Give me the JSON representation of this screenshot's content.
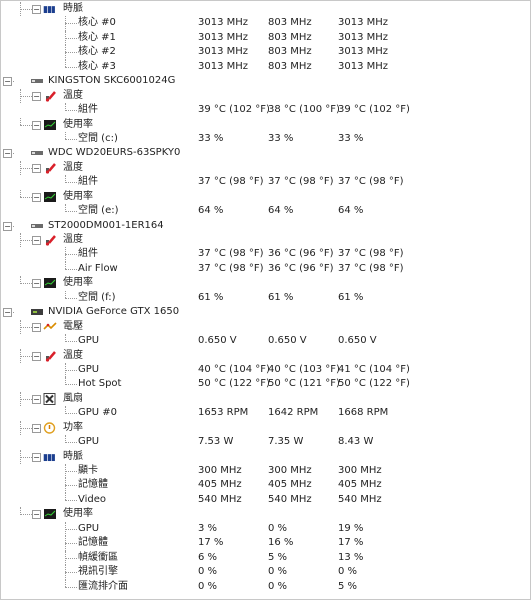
{
  "rows": [
    {
      "level": 1,
      "type": "group",
      "icon": "clock-icon",
      "label": "時脈",
      "last": false
    },
    {
      "level": 2,
      "type": "item",
      "label": "核心 #0",
      "values": [
        "3013 MHz",
        "803 MHz",
        "3013 MHz"
      ],
      "last": false
    },
    {
      "level": 2,
      "type": "item",
      "label": "核心 #1",
      "values": [
        "3013 MHz",
        "803 MHz",
        "3013 MHz"
      ],
      "last": false
    },
    {
      "level": 2,
      "type": "item",
      "label": "核心 #2",
      "values": [
        "3013 MHz",
        "803 MHz",
        "3013 MHz"
      ],
      "last": false
    },
    {
      "level": 2,
      "type": "item",
      "label": "核心 #3",
      "values": [
        "3013 MHz",
        "803 MHz",
        "3013 MHz"
      ],
      "last": true
    },
    {
      "level": 0,
      "type": "device",
      "icon": "drive-icon",
      "label": "KINGSTON SKC6001024G"
    },
    {
      "level": 1,
      "type": "group",
      "icon": "thermometer-icon",
      "label": "溫度",
      "last": false
    },
    {
      "level": 2,
      "type": "item",
      "label": "組件",
      "values": [
        "39 °C  (102 °F)",
        "38 °C  (100 °F)",
        "39 °C  (102 °F)"
      ],
      "last": true
    },
    {
      "level": 1,
      "type": "group",
      "icon": "usage-icon",
      "label": "使用率",
      "last": true
    },
    {
      "level": 2,
      "type": "item",
      "label": "空間 (c:)",
      "values": [
        "33 %",
        "33 %",
        "33 %"
      ],
      "last": true
    },
    {
      "level": 0,
      "type": "device",
      "icon": "drive-icon",
      "label": "WDC WD20EURS-63SPKY0"
    },
    {
      "level": 1,
      "type": "group",
      "icon": "thermometer-icon",
      "label": "溫度",
      "last": false
    },
    {
      "level": 2,
      "type": "item",
      "label": "組件",
      "values": [
        "37 °C  (98 °F)",
        "37 °C  (98 °F)",
        "37 °C  (98 °F)"
      ],
      "last": true
    },
    {
      "level": 1,
      "type": "group",
      "icon": "usage-icon",
      "label": "使用率",
      "last": true
    },
    {
      "level": 2,
      "type": "item",
      "label": "空間 (e:)",
      "values": [
        "64 %",
        "64 %",
        "64 %"
      ],
      "last": true
    },
    {
      "level": 0,
      "type": "device",
      "icon": "drive-icon",
      "label": "ST2000DM001-1ER164"
    },
    {
      "level": 1,
      "type": "group",
      "icon": "thermometer-icon",
      "label": "溫度",
      "last": false
    },
    {
      "level": 2,
      "type": "item",
      "label": "組件",
      "values": [
        "37 °C  (98 °F)",
        "36 °C  (96 °F)",
        "37 °C  (98 °F)"
      ],
      "last": false
    },
    {
      "level": 2,
      "type": "item",
      "label": "Air Flow",
      "values": [
        "37 °C  (98 °F)",
        "36 °C  (96 °F)",
        "37 °C  (98 °F)"
      ],
      "last": true
    },
    {
      "level": 1,
      "type": "group",
      "icon": "usage-icon",
      "label": "使用率",
      "last": true
    },
    {
      "level": 2,
      "type": "item",
      "label": "空間 (f:)",
      "values": [
        "61 %",
        "61 %",
        "61 %"
      ],
      "last": true
    },
    {
      "level": 0,
      "type": "device",
      "icon": "gpu-icon",
      "label": "NVIDIA GeForce GTX 1650"
    },
    {
      "level": 1,
      "type": "group",
      "icon": "voltage-icon",
      "label": "電壓",
      "last": false
    },
    {
      "level": 2,
      "type": "item",
      "label": "GPU",
      "values": [
        "0.650 V",
        "0.650 V",
        "0.650 V"
      ],
      "last": true
    },
    {
      "level": 1,
      "type": "group",
      "icon": "thermometer-icon",
      "label": "溫度",
      "last": false
    },
    {
      "level": 2,
      "type": "item",
      "label": "GPU",
      "values": [
        "40 °C  (104 °F)",
        "40 °C  (103 °F)",
        "41 °C  (104 °F)"
      ],
      "last": false
    },
    {
      "level": 2,
      "type": "item",
      "label": "Hot Spot",
      "values": [
        "50 °C  (122 °F)",
        "50 °C  (121 °F)",
        "50 °C  (122 °F)"
      ],
      "last": true
    },
    {
      "level": 1,
      "type": "group",
      "icon": "fan-icon",
      "label": "風扇",
      "last": false
    },
    {
      "level": 2,
      "type": "item",
      "label": "GPU #0",
      "values": [
        "1653 RPM",
        "1642 RPM",
        "1668 RPM"
      ],
      "last": true
    },
    {
      "level": 1,
      "type": "group",
      "icon": "power-icon",
      "label": "功率",
      "last": false
    },
    {
      "level": 2,
      "type": "item",
      "label": "GPU",
      "values": [
        "7.53 W",
        "7.35 W",
        "8.43 W"
      ],
      "last": true
    },
    {
      "level": 1,
      "type": "group",
      "icon": "clock-icon",
      "label": "時脈",
      "last": false
    },
    {
      "level": 2,
      "type": "item",
      "label": "顯卡",
      "values": [
        "300 MHz",
        "300 MHz",
        "300 MHz"
      ],
      "last": false
    },
    {
      "level": 2,
      "type": "item",
      "label": "記憶體",
      "values": [
        "405 MHz",
        "405 MHz",
        "405 MHz"
      ],
      "last": false
    },
    {
      "level": 2,
      "type": "item",
      "label": "Video",
      "values": [
        "540 MHz",
        "540 MHz",
        "540 MHz"
      ],
      "last": true
    },
    {
      "level": 1,
      "type": "group",
      "icon": "usage-icon",
      "label": "使用率",
      "last": true
    },
    {
      "level": 2,
      "type": "item",
      "label": "GPU",
      "values": [
        "3 %",
        "0 %",
        "19 %"
      ],
      "last": false
    },
    {
      "level": 2,
      "type": "item",
      "label": "記憶體",
      "values": [
        "17 %",
        "16 %",
        "17 %"
      ],
      "last": false
    },
    {
      "level": 2,
      "type": "item",
      "label": "幀緩衝區",
      "values": [
        "6 %",
        "5 %",
        "13 %"
      ],
      "last": false
    },
    {
      "level": 2,
      "type": "item",
      "label": "視訊引擎",
      "values": [
        "0 %",
        "0 %",
        "0 %"
      ],
      "last": false
    },
    {
      "level": 2,
      "type": "item",
      "label": "匯流排介面",
      "values": [
        "0 %",
        "0 %",
        "5 %"
      ],
      "last": true
    }
  ]
}
